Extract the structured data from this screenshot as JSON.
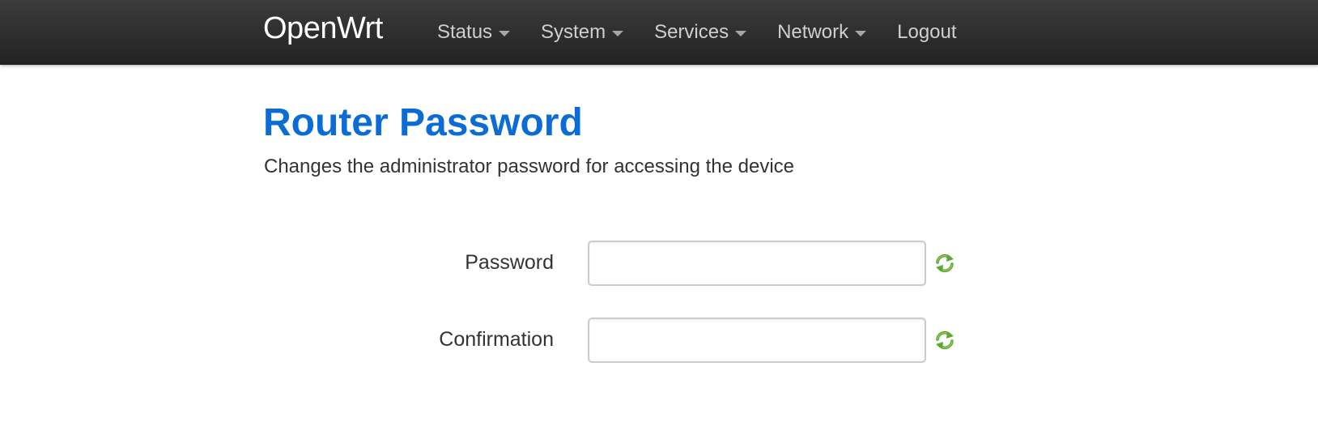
{
  "brand": "OpenWrt",
  "nav": {
    "items": [
      {
        "label": "Status",
        "dropdown": true
      },
      {
        "label": "System",
        "dropdown": true
      },
      {
        "label": "Services",
        "dropdown": true
      },
      {
        "label": "Network",
        "dropdown": true
      },
      {
        "label": "Logout",
        "dropdown": false
      }
    ]
  },
  "page": {
    "title": "Router Password",
    "description": "Changes the administrator password for accessing the device"
  },
  "form": {
    "password": {
      "label": "Password",
      "value": "",
      "icon": "refresh-icon"
    },
    "confirmation": {
      "label": "Confirmation",
      "value": "",
      "icon": "refresh-icon"
    }
  },
  "colors": {
    "title": "#0a6cd4",
    "navbar": "#2a2a2a",
    "icon_green": "#6cb33f"
  }
}
